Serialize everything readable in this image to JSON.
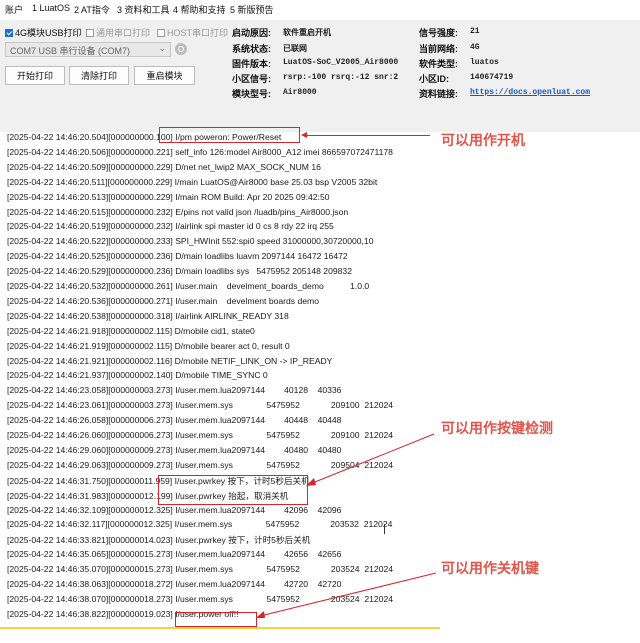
{
  "menu": [
    "账户",
    "1 LuatOS",
    "2 AT指令",
    "3 资料和工具",
    "4 帮助和支持",
    "5 新版预告"
  ],
  "options": {
    "usb_print": "4G模块USB打印",
    "serial_print": "通用串口打印",
    "host_print": "HOST串口打印"
  },
  "port": {
    "value": "COM7 USB 串行设备 (COM7)"
  },
  "buttons": {
    "start": "开始打印",
    "clear": "清除打印",
    "restart": "重启模块"
  },
  "info": {
    "boot_reason_label": "启动原因:",
    "boot_reason": "软件重启开机",
    "status_label": "系统状态:",
    "status": "已联网",
    "firmware_label": "固件版本:",
    "firmware": "LuatOS-SoC_V2005_Air8000",
    "cell_label": "小区信号:",
    "cell": "rsrp:-100 rsrq:-12 snr:2",
    "model_label": "模块型号:",
    "model": "Air8000",
    "signal_label": "信号强度:",
    "signal": "21",
    "network_label": "当前网络:",
    "network": "4G",
    "software_label": "软件类型:",
    "software": "luatos",
    "cellid_label": "小区ID:",
    "cellid": "140674719",
    "docs_label": "资料链接:",
    "docs": "https://docs.openluat.com"
  },
  "log_lines": [
    "[2025-04-22 14:46:20.504][000000000.100] I/pm poweron: Power/Reset",
    "[2025-04-22 14:46:20.506][000000000.221] self_info 126:model Air8000_A12 imei 866597072471178",
    "[2025-04-22 14:46:20.509][000000000.229] D/net net_lwip2 MAX_SOCK_NUM 16",
    "[2025-04-22 14:46:20.511][000000000.229] I/main LuatOS@Air8000 base 25.03 bsp V2005 32bit",
    "[2025-04-22 14:46:20.513][000000000.229] I/main ROM Build: Apr 20 2025 09:42:50",
    "[2025-04-22 14:46:20.515][000000000.232] E/pins not valid json /luadb/pins_Air8000.json",
    "[2025-04-22 14:46:20.519][000000000.232] I/airlink spi master id 0 cs 8 rdy 22 irq 255",
    "[2025-04-22 14:46:20.522][000000000.233] SPI_HWInit 552:spi0 speed 31000000,30720000,10",
    "[2025-04-22 14:46:20.525][000000000.236] D/main loadlibs luavm 2097144 16472 16472",
    "[2025-04-22 14:46:20.529][000000000.236] D/main loadlibs sys   5475952 205148 209832",
    "[2025-04-22 14:46:20.532][000000000.261] I/user.main    develment_boards_demo           1.0.0",
    "[2025-04-22 14:46:20.536][000000000.271] I/user.main    develment boards demo",
    "[2025-04-22 14:46:20.538][000000000.318] I/airlink AIRLINK_READY 318",
    "[2025-04-22 14:46:21.918][000000002.115] D/mobile cid1, state0",
    "[2025-04-22 14:46:21.919][000000002.115] D/mobile bearer act 0, result 0",
    "[2025-04-22 14:46:21.921][000000002.116] D/mobile NETIF_LINK_ON -> IP_READY",
    "[2025-04-22 14:46:21.937][000000002.140] D/mobile TIME_SYNC 0",
    "[2025-04-22 14:46:23.058][000000003.273] I/user.mem.lua2097144        40128    40336",
    "[2025-04-22 14:46:23.061][000000003.273] I/user.mem.sys              5475952             209100  212024",
    "[2025-04-22 14:46:26.058][000000006.273] I/user.mem.lua2097144        40448    40448",
    "[2025-04-22 14:46:26.060][000000006.273] I/user.mem.sys              5475952             209100  212024",
    "[2025-04-22 14:46:29.060][000000009.273] I/user.mem.lua2097144        40480    40480",
    "[2025-04-22 14:46:29.063][000000009.273] I/user.mem.sys              5475952             209504  212024",
    "[2025-04-22 14:46:31.750][000000011.959] I/user.pwrkey 按下，计时5秒后关机",
    "[2025-04-22 14:46:31.983][000000012.199] I/user.pwrkey 抬起，取消关机",
    "[2025-04-22 14:46:32.109][000000012.325] I/user.mem.lua2097144        42096    42096",
    "[2025-04-22 14:46:32.117][000000012.325] I/user.mem.sys              5475952             203532  212024",
    "[2025-04-22 14:46:33.821][000000014.023] I/user.pwrkey 按下，计时5秒后关机",
    "[2025-04-22 14:46:35.065][000000015.273] I/user.mem.lua2097144        42656    42656",
    "[2025-04-22 14:46:35.070][000000015.273] I/user.mem.sys              5475952             203524  212024",
    "[2025-04-22 14:46:38.063][000000018.272] I/user.mem.lua2097144        42720    42720",
    "[2025-04-22 14:46:38.070][000000018.273] I/user.mem.sys              5475952             203524  212024",
    "[2025-04-22 14:46:38.822][000000019.023] I/user.power off!!"
  ],
  "annotations": {
    "poweron": "可以用作开机",
    "key_detect": "可以用作按键检测",
    "poweroff_key": "可以用作关机键"
  },
  "colors": {
    "annotation": "#e0564a",
    "highlight": "#d9232d",
    "link": "#1a56c8",
    "accent": "#1e6fd0"
  }
}
